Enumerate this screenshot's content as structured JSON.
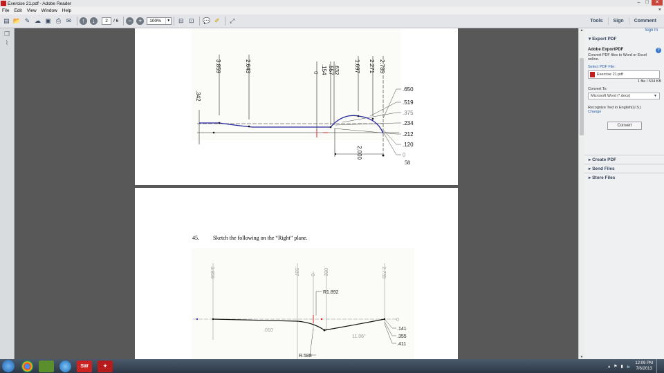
{
  "window": {
    "title": "Exercise 21.pdf - Adobe Reader",
    "controls": [
      "–",
      "□",
      "✕"
    ]
  },
  "menu": {
    "items": [
      "File",
      "Edit",
      "View",
      "Window",
      "Help"
    ],
    "close": "×"
  },
  "toolbar": {
    "page_current": "2",
    "page_total": "/ 6",
    "zoom": "100%",
    "tabs": [
      "Tools",
      "Sign",
      "Comment"
    ]
  },
  "page1": {
    "dims_top": [
      "3.859",
      "2.643",
      ".154",
      "0",
      ".632",
      ".557",
      "1.697",
      "2.271",
      "2.735"
    ],
    "dim_left": ".342",
    "dims_right": [
      ".650",
      ".519",
      ".375",
      ".234",
      ".212",
      ".120",
      "0"
    ],
    "dim_bottom": "2.000",
    "page_number": "58"
  },
  "page2": {
    "problem_number": "45.",
    "problem_text": "Sketch the following on the “Right” plane.",
    "dims_top": [
      "3.859",
      ".537",
      "0",
      ".002",
      "2.735"
    ],
    "labels": {
      "radius1": "R1.892",
      "radius2": "R.588",
      "angle1": ".010",
      "angle2": "11.06°",
      "right0": "0",
      "right1": ".141",
      "right2": ".355",
      "right3": ".411"
    }
  },
  "right_panel": {
    "sign_in": "Sign In",
    "export_header": "Export PDF",
    "export_title": "Adobe ExportPDF",
    "export_desc": "Convert PDF files to Word or Excel online.",
    "select_label": "Select PDF File:",
    "file_name": "Exercise 21.pdf",
    "file_info": "1 file / 534 KB",
    "convert_to_label": "Convert To:",
    "convert_to_value": "Microsoft Word (*.docx)",
    "recognize": "Recognize Text in English(U.S.)",
    "change": "Change",
    "convert_btn": "Convert",
    "sections": [
      "Create PDF",
      "Send Files",
      "Store Files"
    ]
  },
  "taskbar": {
    "apps": [
      "chrome",
      "minecraft",
      "safari",
      "solidworks",
      "acrobat"
    ],
    "time": "12:09 PM",
    "date": "7/6/2013"
  }
}
